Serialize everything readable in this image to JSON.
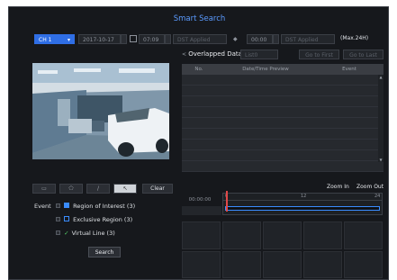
{
  "title": "Smart Search",
  "toolbar": {
    "channel": "CH 1",
    "start_date": "2017-10-17",
    "start_time": "07:09",
    "start_dst": "DST Applied",
    "end_time": "00:00",
    "end_dst": "DST Applied",
    "max_note": "(Max.24H)"
  },
  "overlap": {
    "label": "Overlapped Data",
    "list_value": "List0",
    "go_first": "Go to First",
    "go_last": "Go to Last"
  },
  "table": {
    "columns": [
      "No.",
      "Date/Time Preview",
      "Event"
    ]
  },
  "tools": {
    "clear_label": "Clear"
  },
  "event": {
    "label": "Event",
    "items": [
      {
        "label": "Region of Interest (3)",
        "color": "#3a8cff"
      },
      {
        "label": "Exclusive Region (3)",
        "color": "#3a8cff"
      },
      {
        "label": "Virtual Line (3)",
        "color": "#55d06a"
      }
    ]
  },
  "search_label": "Search",
  "zoom": {
    "in": "Zoom In",
    "out": "Zoom Out"
  },
  "timeline": {
    "time": "00:00:00",
    "ticks": [
      "0",
      "12",
      "24"
    ]
  }
}
